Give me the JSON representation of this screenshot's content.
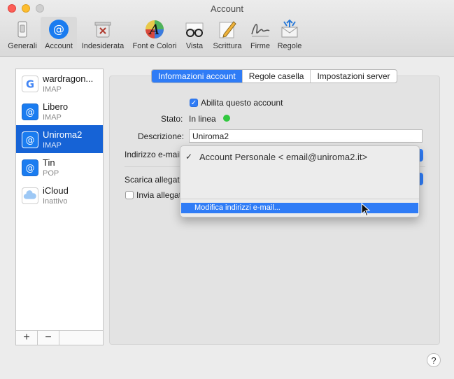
{
  "window": {
    "title": "Account"
  },
  "toolbar": [
    {
      "label": "Generali",
      "icon": "general-switch-icon"
    },
    {
      "label": "Account",
      "icon": "at-sign-icon"
    },
    {
      "label": "Indesiderata",
      "icon": "trash-junk-icon"
    },
    {
      "label": "Font e Colori",
      "icon": "font-colors-icon"
    },
    {
      "label": "Vista",
      "icon": "glasses-icon"
    },
    {
      "label": "Scrittura",
      "icon": "pencil-compose-icon"
    },
    {
      "label": "Firme",
      "icon": "signature-icon"
    },
    {
      "label": "Regole",
      "icon": "rules-envelope-icon"
    }
  ],
  "accounts": [
    {
      "name": "wardragon...",
      "type": "IMAP",
      "icon": "google-icon"
    },
    {
      "name": "Libero",
      "type": "IMAP",
      "icon": "at-sign-icon"
    },
    {
      "name": "Uniroma2",
      "type": "IMAP",
      "icon": "at-sign-icon",
      "selected": true
    },
    {
      "name": "Tin",
      "type": "POP",
      "icon": "at-sign-icon"
    },
    {
      "name": "iCloud",
      "type": "Inattivo",
      "icon": "cloud-icon"
    }
  ],
  "sidebar_buttons": {
    "add": "+",
    "remove": "−"
  },
  "tabs": [
    "Informazioni account",
    "Regole casella",
    "Impostazioni server"
  ],
  "form": {
    "enable_label": "Abilita questo account",
    "status_label": "Stato:",
    "status_value": "In linea",
    "description_label": "Descrizione:",
    "description_value": "Uniroma2",
    "email_label": "Indirizzo e-mail",
    "download_label": "Scarica allegati",
    "send_label": "Invia allegat"
  },
  "menu": {
    "checked_item": "Account Personale < email@uniroma2.it>",
    "edit_item": "Modifica indirizzi e-mail..."
  },
  "help": "?"
}
